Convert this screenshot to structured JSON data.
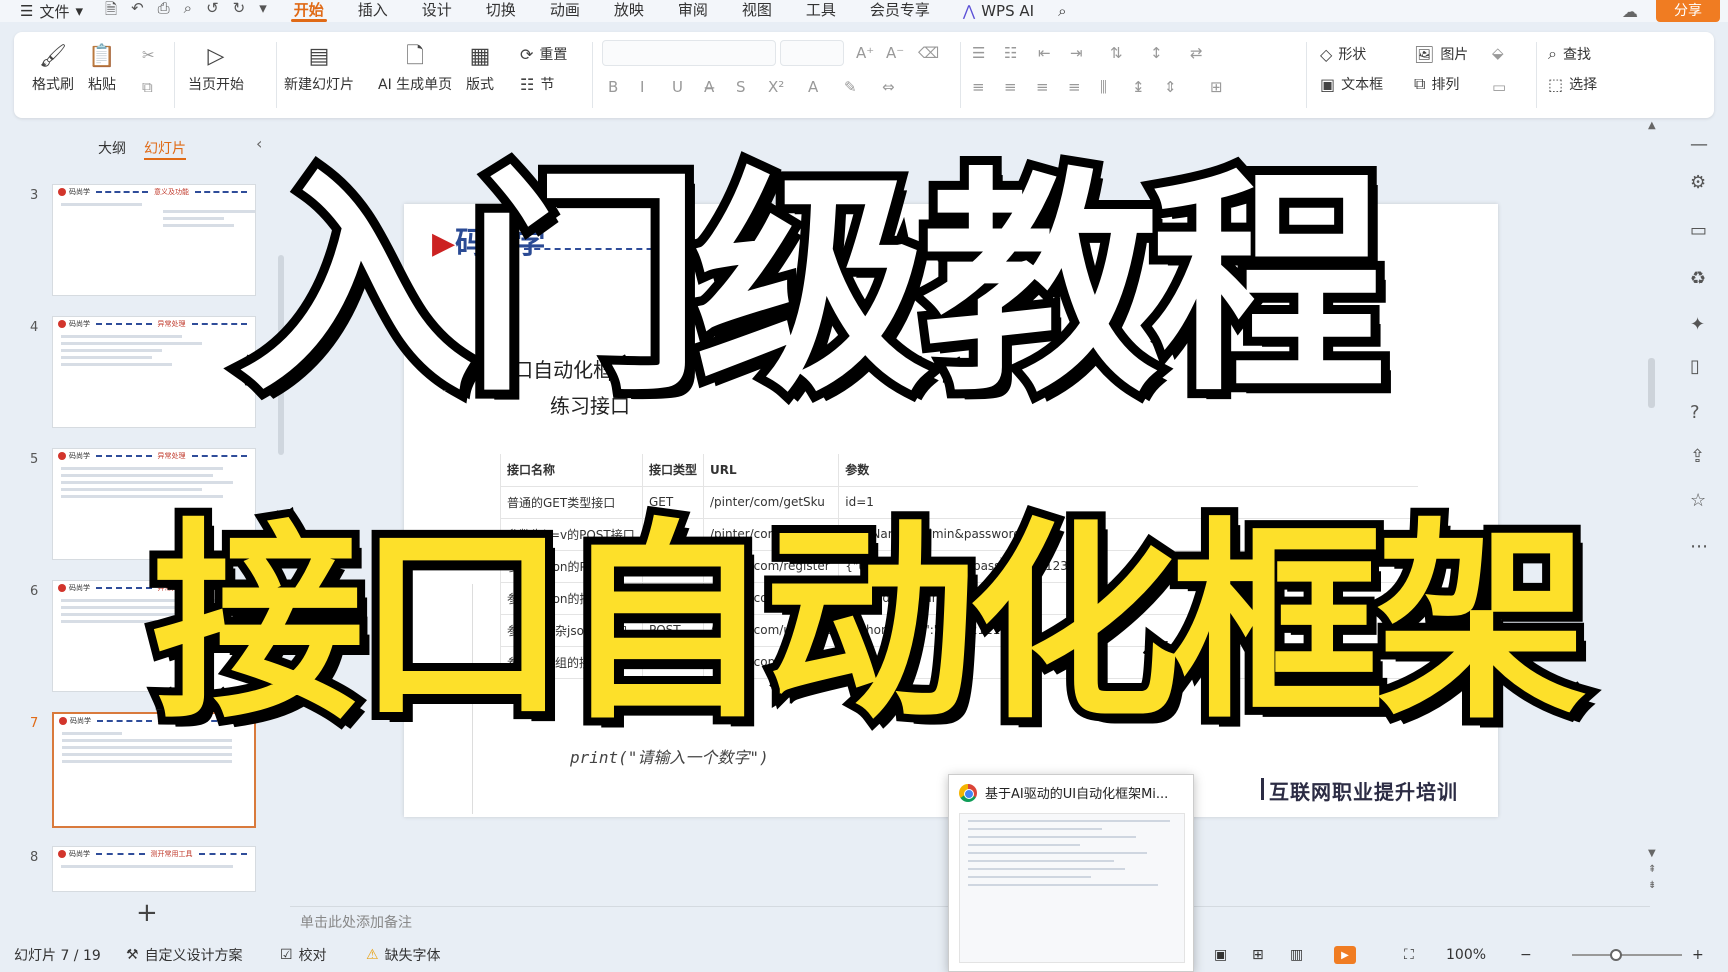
{
  "menubar": {
    "file": "文件",
    "tabs": [
      "开始",
      "插入",
      "设计",
      "切换",
      "动画",
      "放映",
      "审阅",
      "视图",
      "工具",
      "会员专享"
    ],
    "wps_ai": "WPS AI",
    "share": "分享"
  },
  "ribbon": {
    "format_painter": "格式刷",
    "paste": "粘贴",
    "start_from_current": "当页开始",
    "new_slide": "新建幻灯片",
    "ai_generate": "AI 生成单页",
    "layout": "版式",
    "reset": "重置",
    "section": "节",
    "shape": "形状",
    "picture": "图片",
    "textbox": "文本框",
    "arrange": "排列",
    "find": "查找",
    "select": "选择"
  },
  "panel": {
    "tab_outline": "大纲",
    "tab_slides": "幻灯片",
    "slides": [
      {
        "num": "3",
        "title": "意义及功能"
      },
      {
        "num": "4",
        "title": "异常处理"
      },
      {
        "num": "5",
        "title": "异常处理"
      },
      {
        "num": "6",
        "title": "异常处理"
      },
      {
        "num": "7",
        "title": "异常处理"
      },
      {
        "num": "8",
        "title": "测开常用工具"
      }
    ]
  },
  "slide": {
    "logo": "码尚学",
    "section": "4 接口自动化框架",
    "subsection": "练习接口",
    "table": {
      "headers": [
        "接口名称",
        "接口类型",
        "URL",
        "参数"
      ],
      "rows": [
        [
          "普通的GET类型接口",
          "GET",
          "/pinter/com/getSku",
          "id=1"
        ],
        [
          "参数为k=v的POST接口",
          "POST",
          "/pinter/com/login",
          "userName=admin&password=123"
        ],
        [
          "参数为json的POST接口",
          "POST",
          "/pinter/com/register",
          "{\"userName\":\"test\",\"password\":\"1234\"}"
        ],
        [
          "参数为json的接口",
          "POST",
          "/pinter/com/buy",
          "{\"skuId\":1,\"num\":10}"
        ],
        [
          "参数为复杂json的接口",
          "POST",
          "/pinter/com/userInfo",
          "{\"phoneNum\":\"12112121212\"}"
        ],
        [
          "参数为数组的接口",
          "POST",
          "/pinter/com/",
          "[]"
        ]
      ]
    },
    "code": "print(\"请输入一个数字\")",
    "footer": "互联网职业提升培训"
  },
  "overlay": {
    "line1": "入门级教程",
    "line2": "接口自动化框架"
  },
  "popup": {
    "title": "基于AI驱动的UI自动化框架Mi..."
  },
  "notes": "单击此处添加备注",
  "status": {
    "slide_info": "幻灯片 7 / 19",
    "custom_design": "自定义设计方案",
    "proof": "校对",
    "missing_font": "缺失字体",
    "zoom": "100%"
  },
  "colors": {
    "accent": "#e06a16",
    "share_bg": "#f07c22",
    "overlay_white": "#ffffff",
    "overlay_yellow": "#fde02a"
  }
}
